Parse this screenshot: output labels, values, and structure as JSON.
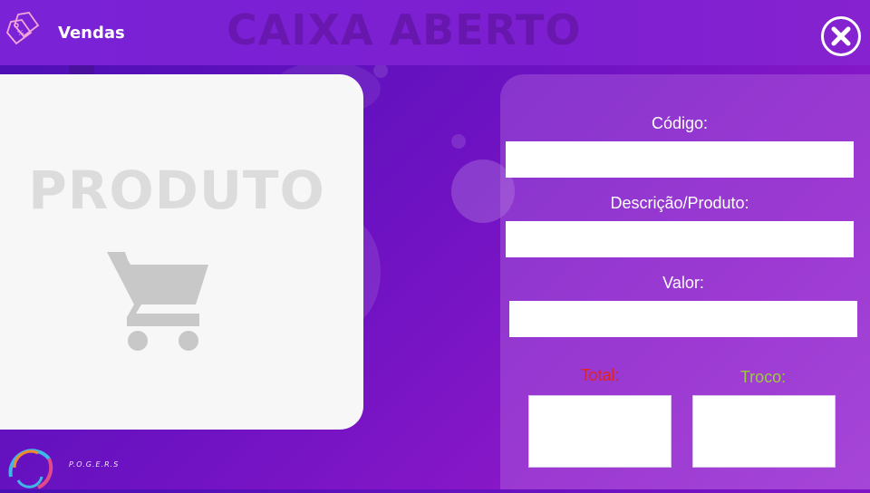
{
  "header": {
    "app_title": "Vendas",
    "status_title": "CAIXA ABERTO",
    "tag_icon": "price-tag-icon",
    "close_icon": "close-icon"
  },
  "product": {
    "label": "PRODUTO",
    "icon": "shopping-cart-icon"
  },
  "form": {
    "codigo_label": "Código:",
    "codigo_value": "",
    "descricao_label": "Descrição/Produto:",
    "descricao_value": "",
    "valor_label": "Valor:",
    "valor_value": ""
  },
  "summary": {
    "total_label": "Total:",
    "total_value": "",
    "troco_label": "Troco:",
    "troco_value": ""
  },
  "footer": {
    "brand": "P.O.G.E.R.S",
    "logo_icon": "ring-logo-icon"
  },
  "colors": {
    "total_label": "#e0241f",
    "troco_label": "#9ccc3b",
    "background": "#6d12c2"
  }
}
